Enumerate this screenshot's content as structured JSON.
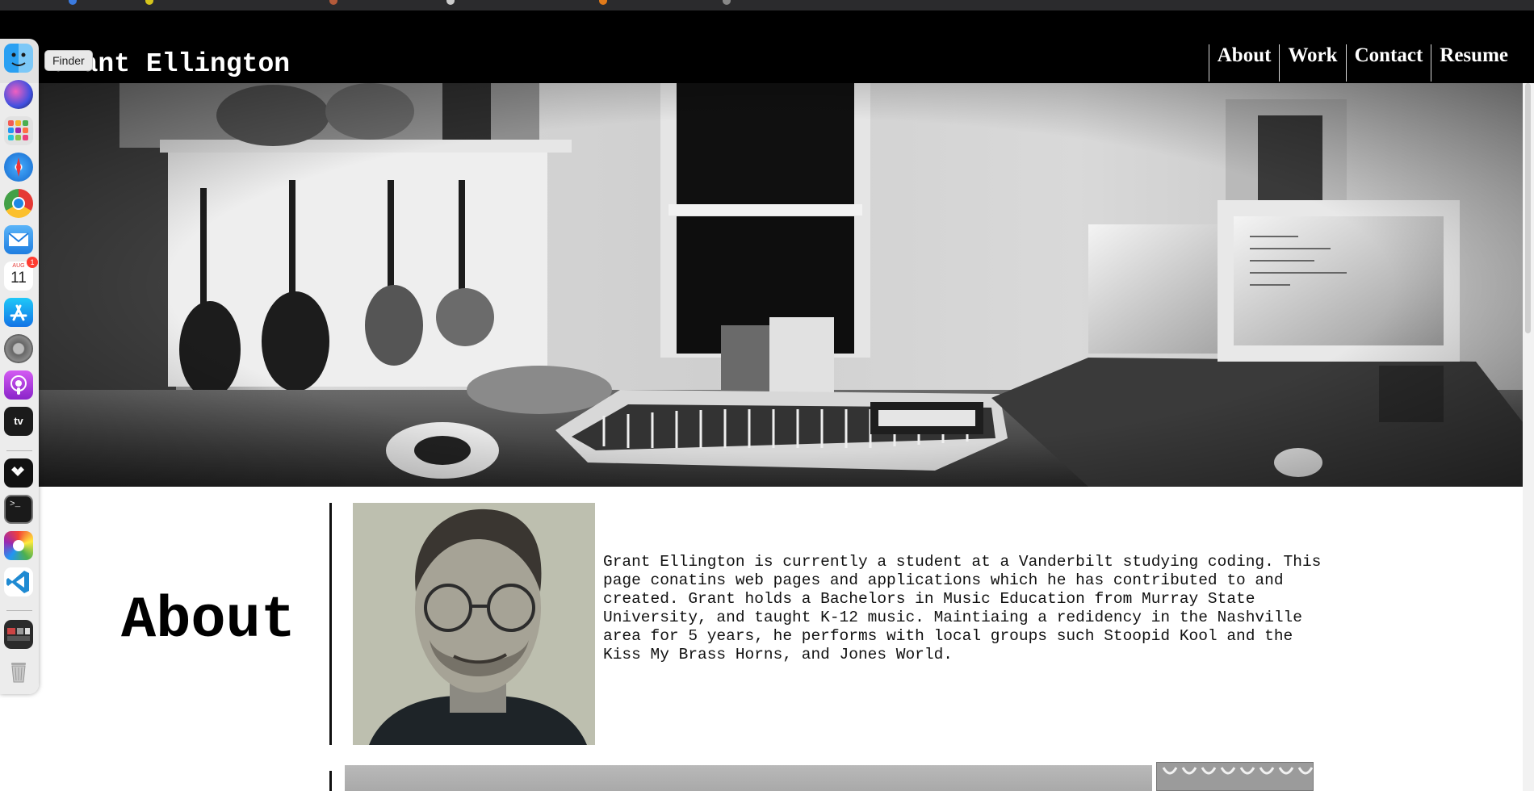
{
  "site": {
    "title": "Grant Ellington",
    "nav": [
      {
        "label": "About"
      },
      {
        "label": "Work"
      },
      {
        "label": "Contact"
      },
      {
        "label": "Resume"
      }
    ]
  },
  "about": {
    "heading": "About",
    "text": "Grant Ellington is currently a student at a Vanderbilt studying coding. This page conatins web pages and applications which he has contributed to and created. Grant holds a Bachelors in Music Education from Murray State University, and taught K-12 music. Maintiaing a redidency in the Nashville area for 5 years, he performs with local groups such Stoopid Kool and the Kiss My Brass Horns, and Jones World."
  },
  "dock": {
    "tooltip": "Finder",
    "apps": [
      {
        "name": "Finder",
        "icon": "finder-icon"
      },
      {
        "name": "Siri",
        "icon": "siri-icon"
      },
      {
        "name": "Launchpad",
        "icon": "launchpad-icon"
      },
      {
        "name": "Safari",
        "icon": "safari-icon"
      },
      {
        "name": "Chrome",
        "icon": "chrome-icon"
      },
      {
        "name": "Mail",
        "icon": "mail-icon"
      },
      {
        "name": "Calendar",
        "icon": "calendar-icon",
        "month": "AUG",
        "day": "11",
        "badge": "1"
      },
      {
        "name": "App Store",
        "icon": "app-store-icon"
      },
      {
        "name": "System Preferences",
        "icon": "settings-icon"
      },
      {
        "name": "Podcasts",
        "icon": "podcasts-icon"
      },
      {
        "name": "TV",
        "icon": "tv-icon",
        "label": "tv"
      },
      {
        "name": "Tidal",
        "icon": "tidal-icon"
      },
      {
        "name": "Terminal",
        "icon": "terminal-icon",
        "label": ">_"
      },
      {
        "name": "Color Picker",
        "icon": "color-picker-icon"
      },
      {
        "name": "VS Code",
        "icon": "vscode-icon"
      },
      {
        "name": "Downloads",
        "icon": "downloads-stack-icon"
      },
      {
        "name": "Trash",
        "icon": "trash-icon"
      }
    ]
  },
  "colors": {
    "header_bg": "#000000",
    "header_text": "#ffffff",
    "body_bg": "#ffffff",
    "text": "#111111"
  }
}
